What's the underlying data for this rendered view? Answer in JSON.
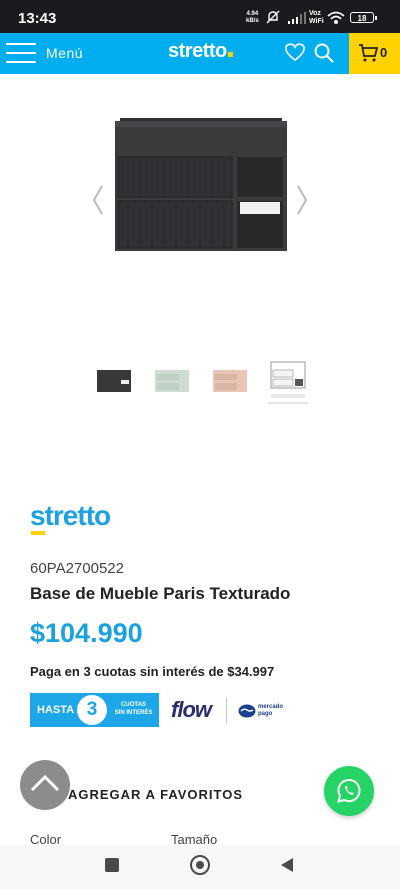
{
  "status_bar": {
    "time": "13:43",
    "net_speed_value": "4.94",
    "net_speed_unit": "kB/s",
    "voz": "Voz",
    "wifi": "WiFi",
    "battery": "18"
  },
  "header": {
    "menu_label": "Menú",
    "logo": "stretto",
    "cart_count": "0",
    "colors": {
      "bar": "#00aef0",
      "cart_bg": "#ffd200"
    }
  },
  "product": {
    "brand": "stretto",
    "sku": "60PA2700522",
    "title": "Base de Mueble Paris Texturado",
    "price": "$104.990",
    "installments_text": "Paga en 3 cuotas sin interés de $34.997",
    "price_color": "#1aa1de",
    "thumbnails": [
      "black-variant",
      "sage-variant",
      "pink-variant",
      "white-variant"
    ]
  },
  "payment": {
    "banner_hasta": "HASTA",
    "banner_number": "3",
    "banner_cuotas_line1": "CUOTAS",
    "banner_cuotas_line2": "SIN INTERÉS",
    "flow_label": "flow",
    "mp_line1": "mercado",
    "mp_line2": "pago"
  },
  "actions": {
    "favorites_label": "AGREGAR A FAVORITOS"
  },
  "options": {
    "color_label": "Color",
    "size_label": "Tamaño"
  }
}
